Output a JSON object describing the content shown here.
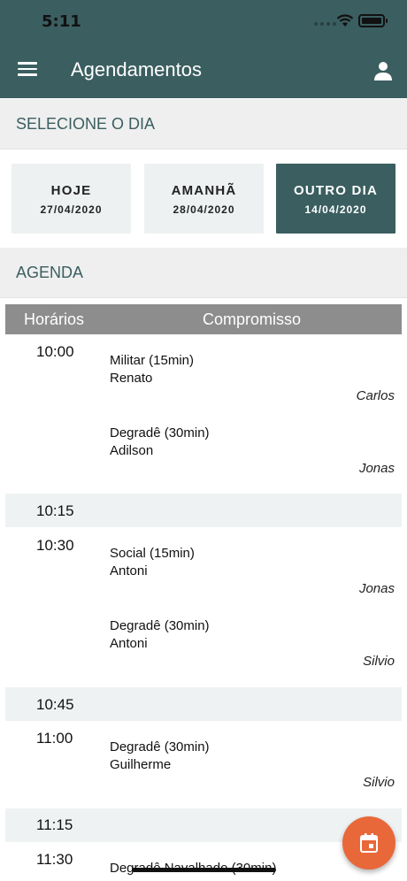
{
  "status": {
    "time": "5:11"
  },
  "appbar": {
    "title": "Agendamentos",
    "menu_icon": "menu-icon",
    "user_icon": "user-icon"
  },
  "select_day": {
    "label": "SELECIONE O DIA",
    "cards": [
      {
        "name": "HOJE",
        "date": "27/04/2020",
        "selected": false
      },
      {
        "name": "AMANHÃ",
        "date": "28/04/2020",
        "selected": false
      },
      {
        "name": "OUTRO DIA",
        "date": "14/04/2020",
        "selected": true
      }
    ]
  },
  "agenda": {
    "label": "AGENDA",
    "headers": {
      "time": "Horários",
      "appointment": "Compromisso"
    },
    "slots": [
      {
        "time": "10:00",
        "appointments": [
          {
            "service": "Militar (15min)",
            "client": "Renato",
            "barber": "Carlos"
          },
          {
            "service": "Degradê (30min)",
            "client": "Adilson",
            "barber": "Jonas"
          }
        ]
      },
      {
        "time": "10:15",
        "appointments": []
      },
      {
        "time": "10:30",
        "appointments": [
          {
            "service": "Social (15min)",
            "client": "Antoni",
            "barber": "Jonas"
          },
          {
            "service": "Degradê (30min)",
            "client": "Antoni",
            "barber": "Silvio"
          }
        ]
      },
      {
        "time": "10:45",
        "appointments": []
      },
      {
        "time": "11:00",
        "appointments": [
          {
            "service": "Degradê (30min)",
            "client": "Guilherme",
            "barber": "Silvio"
          }
        ]
      },
      {
        "time": "11:15",
        "appointments": []
      },
      {
        "time": "11:30",
        "appointments": [
          {
            "service": "Degradê Navalhado (30min)",
            "client": "",
            "barber": ""
          }
        ]
      }
    ]
  },
  "fab": {
    "icon": "calendar-icon"
  },
  "colors": {
    "primary": "#3b5e60",
    "accent": "#e8683a",
    "header_gray": "#8d8d8d"
  }
}
